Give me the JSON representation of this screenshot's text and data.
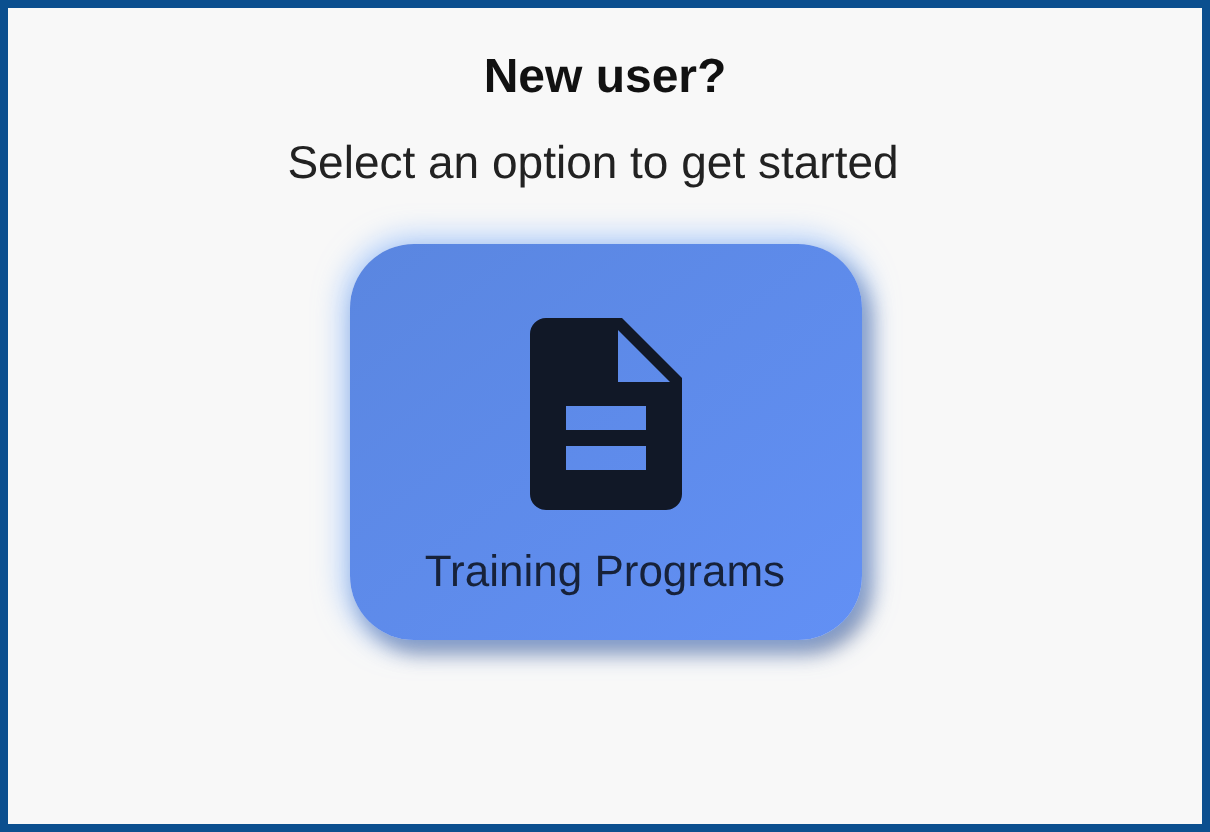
{
  "heading": "New user?",
  "subtitle": "Select an option to get started",
  "options": [
    {
      "label": "Training Programs"
    }
  ]
}
